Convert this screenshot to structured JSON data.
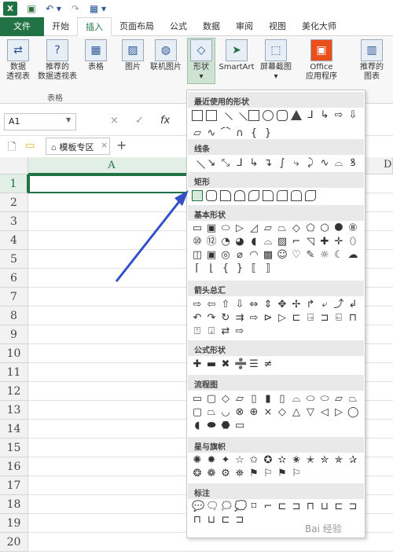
{
  "quick_access": {
    "app_icon": "excel-logo",
    "save_icon": "save-icon",
    "undo_icon": "undo-icon",
    "redo_icon": "redo-icon",
    "more_icon": "customize-icon"
  },
  "tabs": [
    "文件",
    "开始",
    "插入",
    "页面布局",
    "公式",
    "数据",
    "审阅",
    "视图",
    "美化大师"
  ],
  "ribbon": {
    "buttons": [
      {
        "label": "数据\n透视表",
        "icon": "pivot-table-icon"
      },
      {
        "label": "推荐的\n数据透视表",
        "icon": "recommended-pivot-icon"
      },
      {
        "label": "表格",
        "icon": "table-icon"
      },
      {
        "label": "图片",
        "icon": "picture-icon"
      },
      {
        "label": "联机图片",
        "icon": "online-picture-icon"
      },
      {
        "label": "形状",
        "icon": "shapes-icon"
      },
      {
        "label": "SmartArt",
        "icon": "smartart-icon"
      },
      {
        "label": "屏幕截图",
        "icon": "screenshot-icon"
      },
      {
        "label": "Office\n应用程序",
        "icon": "office-icon"
      },
      {
        "label": "推荐的\n图表",
        "icon": "recommended-chart-icon"
      }
    ],
    "group_label": "表格"
  },
  "formula_bar": {
    "name_box": "A1",
    "cancel": "×",
    "enter": "✓",
    "fx": "fx"
  },
  "sheet_bar": {
    "doc_icon": "document-icon",
    "folder_icon": "folder-icon",
    "home_icon": "home-icon",
    "tab_label": "模板专区",
    "close": "×",
    "add": "+"
  },
  "grid": {
    "col_header": "A",
    "col_d": "D",
    "rows": [
      "1",
      "2",
      "3",
      "4",
      "5",
      "6",
      "7",
      "8",
      "9",
      "10",
      "11",
      "12",
      "13",
      "14",
      "15",
      "16",
      "17",
      "18",
      "19",
      "20"
    ]
  },
  "shapes_menu": {
    "sections": [
      {
        "title": "最近使用的形状",
        "count": 22
      },
      {
        "title": "线条",
        "count": 12
      },
      {
        "title": "矩形",
        "count": 9
      },
      {
        "title": "基本形状",
        "count": 42
      },
      {
        "title": "箭头总汇",
        "count": 28
      },
      {
        "title": "公式形状",
        "count": 6
      },
      {
        "title": "流程图",
        "count": 28
      },
      {
        "title": "星与旗帜",
        "count": 20
      },
      {
        "title": "标注",
        "count": 16
      }
    ]
  },
  "watermark": "Bai 经验"
}
